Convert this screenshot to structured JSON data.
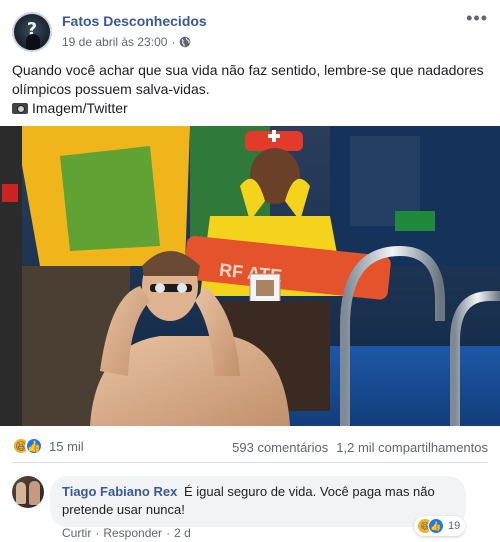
{
  "post": {
    "page_name": "Fatos Desconhecidos",
    "timestamp": "19 de abril às 23:00",
    "dot": "·",
    "privacy_icon": "globe-icon",
    "more_icon": "•••",
    "text_line1": "Quando você achar que sua vida não faz sentido, lembre-se que nadadores",
    "text_line2": "olímpicos possuem salva-vidas.",
    "credit": "Imagem/Twitter",
    "photo_sign_text": "RF  ATE"
  },
  "stats": {
    "reaction_icons": [
      "haha-reaction-icon",
      "like-reaction-icon"
    ],
    "reaction_count": "15 mil",
    "comments": "593 comentários",
    "shares": "1,2 mil compartilhamentos"
  },
  "comment": {
    "author": "Tiago Fabiano Rex",
    "text": "É igual seguro de vida. Você paga mas não pretende usar nunca!",
    "reaction_count": "19",
    "like_label": "Curtir",
    "reply_label": "Responder",
    "sep": "·",
    "time": "2 d"
  },
  "colors": {
    "link_blue": "#385898",
    "meta_gray": "#606770",
    "bubble_bg": "#f2f3f5",
    "lifeguard_red": "#e23a2b",
    "lifeguard_yellow": "#f3d31c"
  }
}
